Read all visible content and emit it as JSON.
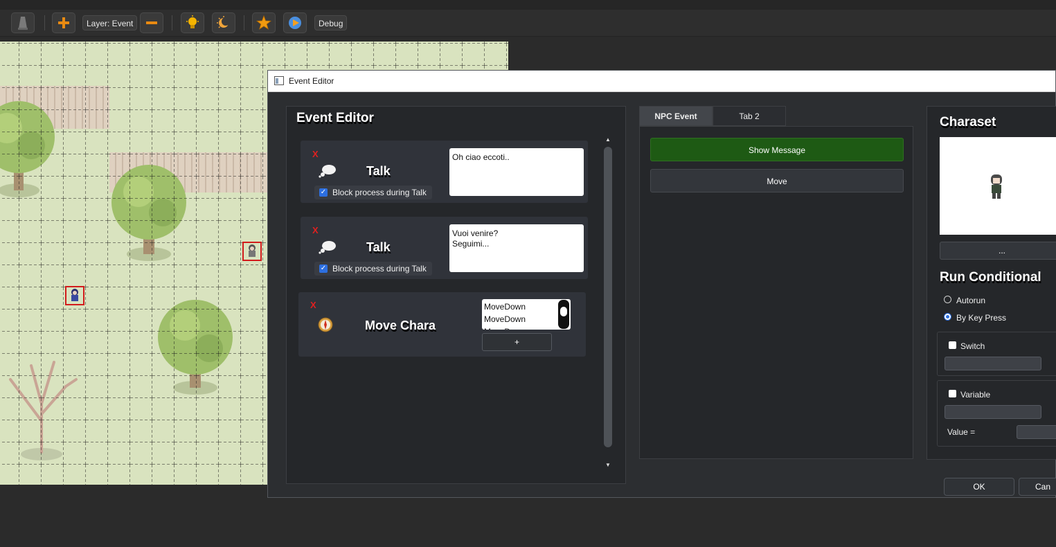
{
  "toolbar": {
    "layer_label": "Layer: Event",
    "debug_label": "Debug",
    "icons": [
      "cone-icon",
      "add-icon",
      "remove-icon",
      "lightbulb-icon",
      "night-icon",
      "star-icon",
      "play-icon"
    ]
  },
  "dialog": {
    "window_title": "Event Editor",
    "editor_panel": {
      "title": "Event Editor",
      "commands": [
        {
          "remove_label": "X",
          "title": "Talk",
          "icon": "thought-bubble-icon",
          "block_label": "Block process during Talk",
          "blocked": true,
          "message": "Oh ciao eccoti.."
        },
        {
          "remove_label": "X",
          "title": "Talk",
          "icon": "thought-bubble-icon",
          "block_label": "Block process during Talk",
          "blocked": true,
          "message": "Vuoi venire?\nSeguimi..."
        },
        {
          "remove_label": "X",
          "title": "Move Chara",
          "icon": "compass-icon",
          "moves": [
            "MoveDown",
            "MoveDown"
          ],
          "add_label": "+"
        }
      ]
    },
    "tabs": [
      "NPC Event",
      "Tab 2"
    ],
    "active_tab": "NPC Event",
    "actions": [
      "Show Message",
      "Move"
    ],
    "charaset": {
      "title": "Charaset",
      "browse_label": "..."
    },
    "run_conditional": {
      "title": "Run Conditional",
      "options": [
        "Autorun",
        "By Key Press"
      ],
      "selected": "By Key Press",
      "switch_label": "Switch",
      "variable_label": "Variable",
      "value_label": "Value  ="
    },
    "ok_label": "OK",
    "cancel_label": "Can"
  },
  "colors": {
    "accent": "#2d6fe0",
    "show_message_bg": "#1e5a14",
    "remove_red": "#e02020",
    "selection_red": "#d21c1c"
  }
}
